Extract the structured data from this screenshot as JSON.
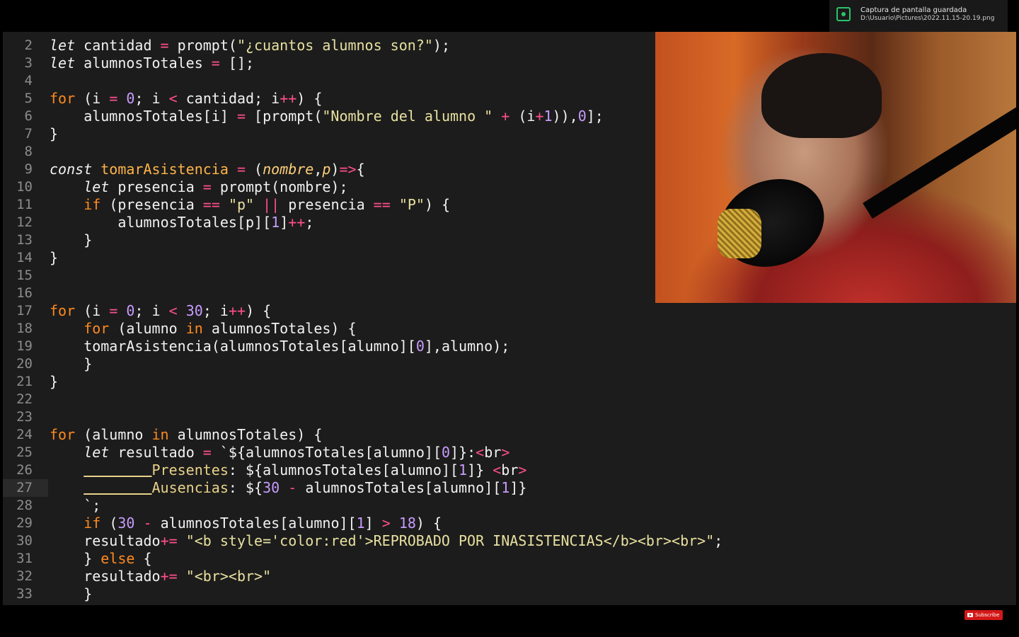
{
  "toast": {
    "title": "Captura de pantalla guardada",
    "path": "D:\\Usuario\\Pictures\\2022.11.15-20.19.png",
    "icon": "screenshot-camera-icon"
  },
  "subscribe": {
    "label": "Subscribe",
    "icon": "youtube-play-icon"
  },
  "editor": {
    "active_line": "27",
    "lines": [
      {
        "n": "2",
        "c": "let cantidad = prompt(\"¿cuantos alumnos son?\");"
      },
      {
        "n": "3",
        "c": "let alumnosTotales = [];"
      },
      {
        "n": "4",
        "c": ""
      },
      {
        "n": "5",
        "c": "for (i = 0; i < cantidad; i++) {"
      },
      {
        "n": "6",
        "c": "    alumnosTotales[i] = [prompt(\"Nombre del alumno \" + (i+1)),0];"
      },
      {
        "n": "7",
        "c": "}"
      },
      {
        "n": "8",
        "c": ""
      },
      {
        "n": "9",
        "c": "const tomarAsistencia = (nombre,p)=>{"
      },
      {
        "n": "10",
        "c": "    let presencia = prompt(nombre);"
      },
      {
        "n": "11",
        "c": "    if (presencia == \"p\" || presencia == \"P\") {"
      },
      {
        "n": "12",
        "c": "        alumnosTotales[p][1]++;"
      },
      {
        "n": "13",
        "c": "    }"
      },
      {
        "n": "14",
        "c": "}"
      },
      {
        "n": "15",
        "c": ""
      },
      {
        "n": "16",
        "c": ""
      },
      {
        "n": "17",
        "c": "for (i = 0; i < 30; i++) {"
      },
      {
        "n": "18",
        "c": "    for (alumno in alumnosTotales) {"
      },
      {
        "n": "19",
        "c": "    tomarAsistencia(alumnosTotales[alumno][0],alumno);"
      },
      {
        "n": "20",
        "c": "    }"
      },
      {
        "n": "21",
        "c": "}"
      },
      {
        "n": "22",
        "c": ""
      },
      {
        "n": "23",
        "c": ""
      },
      {
        "n": "24",
        "c": "for (alumno in alumnosTotales) {"
      },
      {
        "n": "25",
        "c": "    let resultado = `${alumnosTotales[alumno][0]}:<br>"
      },
      {
        "n": "26",
        "c": "    ________Presentes: ${alumnosTotales[alumno][1]} <br>"
      },
      {
        "n": "27",
        "c": "    ________Ausencias: ${30 - alumnosTotales[alumno][1]}"
      },
      {
        "n": "28",
        "c": "    `;"
      },
      {
        "n": "29",
        "c": "    if (30 - alumnosTotales[alumno][1] > 18) {"
      },
      {
        "n": "30",
        "c": "    resultado+= \"<b style='color:red'>REPROBADO POR INASISTENCIAS</b><br><br>\";"
      },
      {
        "n": "31",
        "c": "    } else {"
      },
      {
        "n": "32",
        "c": "    resultado+= \"<br><br>\""
      },
      {
        "n": "33",
        "c": "    }"
      }
    ]
  }
}
